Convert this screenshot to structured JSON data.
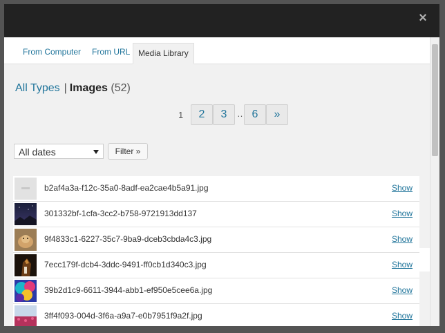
{
  "dialog": {
    "close_label": "×"
  },
  "tabs": [
    {
      "label": "From Computer"
    },
    {
      "label": "From URL"
    },
    {
      "label": "Media Library"
    }
  ],
  "filter": {
    "all_types": "All Types",
    "separator": "|",
    "current": "Images",
    "count": "(52)"
  },
  "pagination": {
    "current": "1",
    "pages": [
      "2",
      "3"
    ],
    "dots": "…",
    "last": "6",
    "next": "»"
  },
  "date_filter": {
    "selected": "All dates",
    "button": "Filter »"
  },
  "media": [
    {
      "filename": "b2af4a3a-f12c-35a0-8adf-ea2cae4b5a91.jpg",
      "show": "Show"
    },
    {
      "filename": "301332bf-1cfa-3cc2-b758-9721913dd137",
      "show": "Show"
    },
    {
      "filename": "9f4833c1-6227-35c7-9ba9-dceb3cbda4c3.jpg",
      "show": "Show"
    },
    {
      "filename": "7ecc179f-dcb4-3ddc-9491-ff0cb1d340c3.jpg",
      "show": "Show"
    },
    {
      "filename": "39b2d1c9-6611-3944-abb1-ef950e5cee6a.jpg",
      "show": "Show"
    },
    {
      "filename": "3ff4f093-004d-3f6a-a9a7-e0b7951f9a2f.jpg",
      "show": "Show"
    }
  ]
}
